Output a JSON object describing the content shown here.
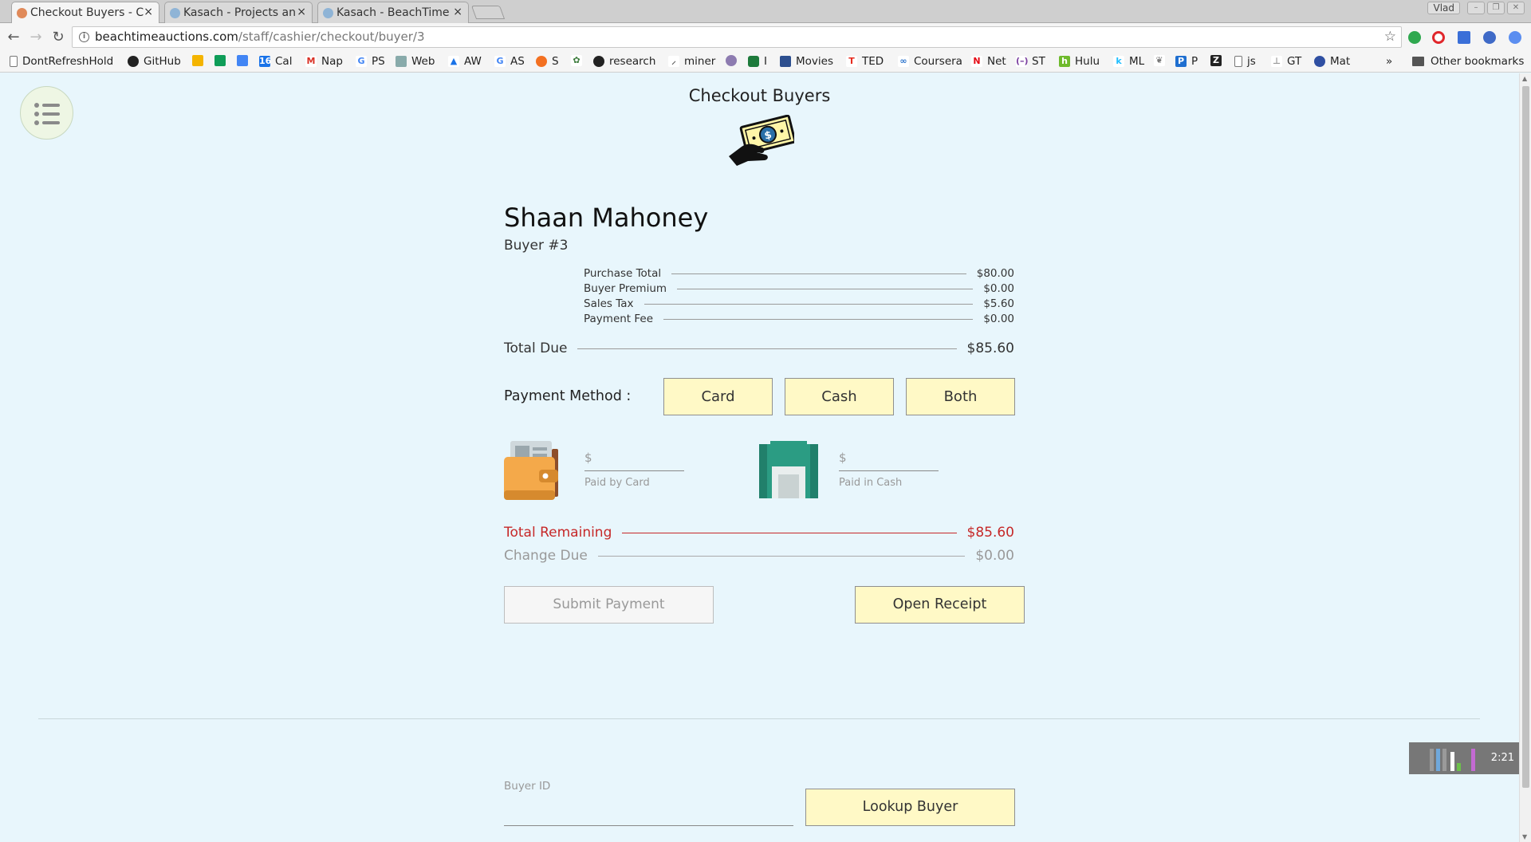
{
  "browser": {
    "tabs": [
      {
        "title": "Checkout Buyers - C",
        "active": true
      },
      {
        "title": "Kasach - Projects an",
        "active": false
      },
      {
        "title": "Kasach - BeachTime",
        "active": false
      }
    ],
    "profile": "Vlad",
    "url_host": "beachtimeauctions.com",
    "url_path": "/staff/cashier/checkout/buyer/3",
    "bookmarks": [
      "DontRefreshHold",
      "GitHub",
      "",
      "",
      "",
      "Cal",
      "Nap",
      "PS",
      "Web",
      "AW",
      "AS",
      "S",
      "",
      "research",
      "miner",
      "",
      "I",
      "Movies",
      "TED",
      "Coursera",
      "Net",
      "ST",
      "Hulu",
      "ML",
      "",
      "P",
      "",
      "js",
      "GT",
      "Mat"
    ],
    "more_bookmarks": "»",
    "other_bookmarks": "Other bookmarks"
  },
  "page": {
    "title": "Checkout Buyers",
    "buyer_name": "Shaan Mahoney",
    "buyer_number": "Buyer #3",
    "line_items": [
      {
        "label": "Purchase Total",
        "amount": "$80.00"
      },
      {
        "label": "Buyer Premium",
        "amount": "$0.00"
      },
      {
        "label": "Sales Tax",
        "amount": "$5.60"
      },
      {
        "label": "Payment Fee",
        "amount": "$0.00"
      }
    ],
    "total_due": {
      "label": "Total Due",
      "amount": "$85.60"
    },
    "payment_method": {
      "label": "Payment Method :",
      "options": [
        "Card",
        "Cash",
        "Both"
      ]
    },
    "card_field": {
      "prefix": "$",
      "hint": "Paid by Card"
    },
    "cash_field": {
      "prefix": "$",
      "hint": "Paid in Cash"
    },
    "total_remaining": {
      "label": "Total Remaining",
      "amount": "$85.60"
    },
    "change_due": {
      "label": "Change Due",
      "amount": "$0.00"
    },
    "submit_label": "Submit Payment",
    "receipt_label": "Open Receipt",
    "buyer_id_label": "Buyer ID",
    "lookup_label": "Lookup Buyer"
  },
  "system_tray": {
    "time": "2:21"
  },
  "colors": {
    "accent_button": "#fff9c6",
    "remaining": "#c62828",
    "background": "#e8f6fc"
  }
}
